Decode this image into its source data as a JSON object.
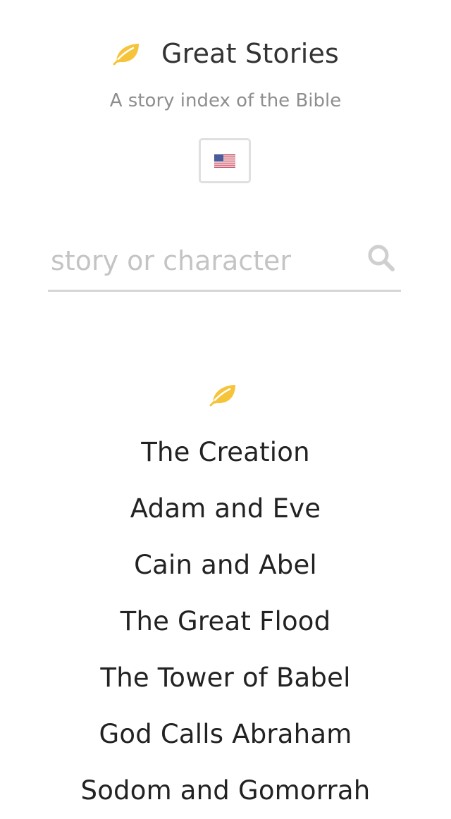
{
  "header": {
    "title": "Great Stories",
    "subtitle": "A story index of the Bible",
    "logo_icon": "leaf-icon",
    "accent_color": "#f5c43a"
  },
  "language": {
    "selected_flag_icon": "us-flag-icon"
  },
  "search": {
    "placeholder": "story or character",
    "value": "",
    "icon": "search-icon"
  },
  "stories": [
    {
      "label": "The Creation"
    },
    {
      "label": "Adam and Eve"
    },
    {
      "label": "Cain and Abel"
    },
    {
      "label": "The Great Flood"
    },
    {
      "label": "The Tower of Babel"
    },
    {
      "label": "God Calls Abraham"
    },
    {
      "label": "Sodom and Gomorrah"
    }
  ]
}
